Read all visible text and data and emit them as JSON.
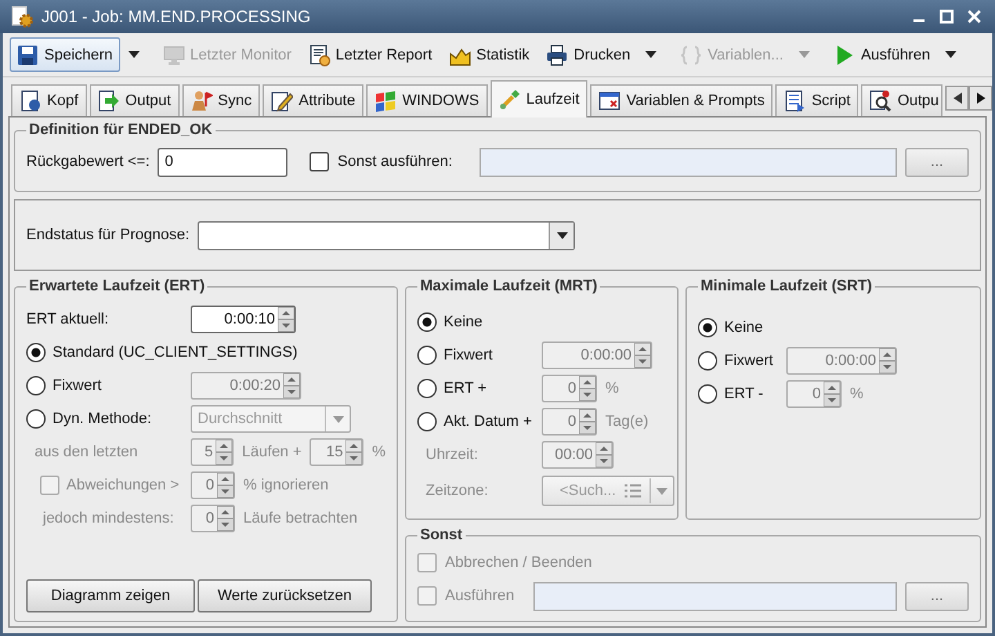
{
  "window": {
    "title": "J001 - Job: MM.END.PROCESSING"
  },
  "toolbar": [
    {
      "label": "Speichern",
      "selected": true,
      "disabled": false,
      "dropdown": true
    },
    {
      "label": "Letzter Monitor",
      "selected": false,
      "disabled": true,
      "dropdown": false
    },
    {
      "label": "Letzter Report",
      "selected": false,
      "disabled": false,
      "dropdown": false
    },
    {
      "label": "Statistik",
      "selected": false,
      "disabled": false,
      "dropdown": false
    },
    {
      "label": "Drucken",
      "selected": false,
      "disabled": false,
      "dropdown": true
    },
    {
      "label": "Variablen...",
      "selected": false,
      "disabled": true,
      "dropdown": true
    },
    {
      "label": "Ausführen",
      "selected": false,
      "disabled": false,
      "dropdown": true
    }
  ],
  "tabs": [
    {
      "label": "Kopf",
      "selected": false
    },
    {
      "label": "Output",
      "selected": false
    },
    {
      "label": "Sync",
      "selected": false
    },
    {
      "label": "Attribute",
      "selected": false
    },
    {
      "label": "WINDOWS",
      "selected": false
    },
    {
      "label": "Laufzeit",
      "selected": true
    },
    {
      "label": "Variablen & Prompts",
      "selected": false
    },
    {
      "label": "Script",
      "selected": false
    },
    {
      "label": "Outpu",
      "selected": false
    }
  ],
  "definition": {
    "title": "Definition für ENDED_OK",
    "return_label": "Rückgabewert <=:",
    "return_value": "0",
    "else_run": {
      "label": "Sonst ausführen:",
      "checked": false
    },
    "browse": "..."
  },
  "forecast": {
    "label": "Endstatus für Prognose:"
  },
  "ert": {
    "title": "Erwartete Laufzeit (ERT)",
    "current_label": "ERT aktuell:",
    "current": {
      "value": "0:00:10",
      "disabled": false
    },
    "options": [
      {
        "label": "Standard (UC_CLIENT_SETTINGS)",
        "selected": true
      },
      {
        "label": "Fixwert",
        "selected": false,
        "field": {
          "value": "0:00:20",
          "disabled": true
        }
      },
      {
        "label": "Dyn. Methode:",
        "selected": false,
        "method": "Durchschnitt"
      }
    ],
    "history": {
      "label": "aus den letzten",
      "runs": {
        "value": "5",
        "disabled": true
      },
      "runs_label": "Läufen +",
      "percent": {
        "value": "15",
        "disabled": true
      },
      "unit": "%"
    },
    "deviation": {
      "label": "Abweichungen >",
      "checked": false,
      "field": {
        "value": "0",
        "disabled": true
      },
      "suffix": "% ignorieren"
    },
    "minimum": {
      "label": "jedoch mindestens:",
      "field": {
        "value": "0",
        "disabled": true
      },
      "suffix": "Läufe betrachten"
    },
    "buttons": [
      "Diagramm zeigen",
      "Werte zurücksetzen"
    ]
  },
  "mrt": {
    "title": "Maximale Laufzeit (MRT)",
    "options": [
      {
        "label": "Keine",
        "selected": true
      },
      {
        "label": "Fixwert",
        "selected": false,
        "field": {
          "value": "0:00:00",
          "disabled": true
        }
      },
      {
        "label": "ERT +",
        "selected": false,
        "field": {
          "value": "0",
          "disabled": true
        },
        "unit": "%"
      },
      {
        "label": "Akt. Datum +",
        "selected": false,
        "field": {
          "value": "0",
          "disabled": true
        },
        "unit": "Tag(e)"
      }
    ],
    "time": {
      "label": "Uhrzeit:",
      "field": {
        "value": "00:00",
        "disabled": true
      }
    },
    "zone": {
      "label": "Zeitzone:",
      "value": "<Such..."
    }
  },
  "srt": {
    "title": "Minimale Laufzeit (SRT)",
    "options": [
      {
        "label": "Keine",
        "selected": true
      },
      {
        "label": "Fixwert",
        "selected": false,
        "field": {
          "value": "0:00:00",
          "disabled": true
        }
      },
      {
        "label": "ERT -",
        "selected": false,
        "field": {
          "value": "0",
          "disabled": true
        },
        "unit": "%"
      }
    ]
  },
  "other": {
    "title": "Sonst",
    "abort": {
      "label": "Abbrechen / Beenden",
      "checked": false,
      "disabled": true
    },
    "run": {
      "label": "Ausführen",
      "checked": false,
      "disabled": true
    },
    "browse": "..."
  }
}
